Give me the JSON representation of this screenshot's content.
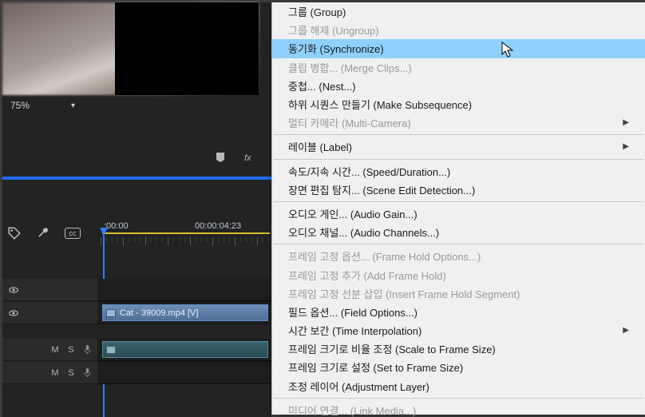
{
  "preview": {
    "zoom": "75%"
  },
  "timeline": {
    "playhead_time": ":00:00",
    "ruler_marks": [
      ":00:00",
      "00:00:04:23"
    ],
    "clip_v1": {
      "name": "Cat - 39009.mp4 [V]"
    },
    "tracks_audio_labels": {
      "m": "M",
      "s": "S"
    }
  },
  "menu": {
    "items": [
      {
        "label": "그룹 (Group)",
        "disabled": false,
        "hover": false
      },
      {
        "label": "그룹 해제 (Ungroup)",
        "disabled": true,
        "hover": false
      },
      {
        "label": "동기화 (Synchronize)",
        "disabled": false,
        "hover": true
      },
      {
        "label": "클립 병합... (Merge Clips...)",
        "disabled": true,
        "hover": false
      },
      {
        "label": "중첩... (Nest...)",
        "disabled": false,
        "hover": false
      },
      {
        "label": "하위 시퀀스 만들기 (Make Subsequence)",
        "disabled": false,
        "hover": false
      },
      {
        "label": "멀티 카메라 (Multi-Camera)",
        "disabled": true,
        "hover": false,
        "sub": true
      },
      {
        "sep": true
      },
      {
        "label": "레이블 (Label)",
        "disabled": false,
        "hover": false,
        "sub": true
      },
      {
        "sep": true
      },
      {
        "label": "속도/지속 시간... (Speed/Duration...)",
        "disabled": false,
        "hover": false
      },
      {
        "label": "장면 편집 탐지... (Scene Edit Detection...)",
        "disabled": false,
        "hover": false
      },
      {
        "sep": true
      },
      {
        "label": "오디오 게인... (Audio Gain...)",
        "disabled": false,
        "hover": false
      },
      {
        "label": "오디오 채널... (Audio Channels...)",
        "disabled": false,
        "hover": false
      },
      {
        "sep": true
      },
      {
        "label": "프레임 고정 옵션... (Frame Hold Options...)",
        "disabled": true,
        "hover": false
      },
      {
        "label": "프레임 고정 추가 (Add Frame Hold)",
        "disabled": true,
        "hover": false
      },
      {
        "label": "프레임 고정 선분 삽입 (Insert Frame Hold Segment)",
        "disabled": true,
        "hover": false
      },
      {
        "label": "필드 옵션... (Field Options...)",
        "disabled": false,
        "hover": false
      },
      {
        "label": "시간 보간 (Time Interpolation)",
        "disabled": false,
        "hover": false,
        "sub": true
      },
      {
        "label": "프레임 크기로 비율 조정 (Scale to Frame Size)",
        "disabled": false,
        "hover": false
      },
      {
        "label": "프레임 크기로 설정 (Set to Frame Size)",
        "disabled": false,
        "hover": false
      },
      {
        "label": "조정 레이어 (Adjustment Layer)",
        "disabled": false,
        "hover": false
      },
      {
        "sep": true
      },
      {
        "label": "미디어 연결... (Link Media...)",
        "disabled": true,
        "hover": false
      }
    ]
  }
}
